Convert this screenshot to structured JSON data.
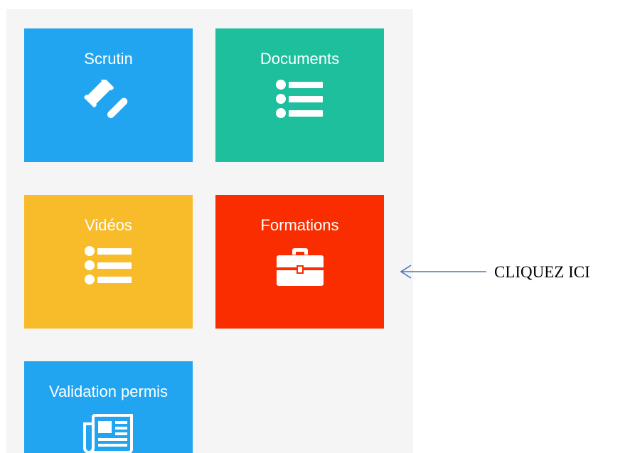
{
  "tiles": [
    {
      "id": "scrutin",
      "label": "Scrutin",
      "icon": "gavel-icon",
      "color": "#21a5f0"
    },
    {
      "id": "documents",
      "label": "Documents",
      "icon": "list-icon",
      "color": "#1dbf9d"
    },
    {
      "id": "videos",
      "label": "Vidéos",
      "icon": "list-icon",
      "color": "#f8bc2b"
    },
    {
      "id": "formations",
      "label": "Formations",
      "icon": "briefcase-icon",
      "color": "#f92d00"
    },
    {
      "id": "validation",
      "label": "Validation permis",
      "icon": "newspaper-icon",
      "color": "#21a5f0"
    }
  ],
  "annotation": {
    "text": "CLIQUEZ ICI",
    "arrow_color": "#4a78b8",
    "target": "formations"
  },
  "colors": {
    "panel_background": "#f5f5f5",
    "page_background": "#ffffff"
  }
}
